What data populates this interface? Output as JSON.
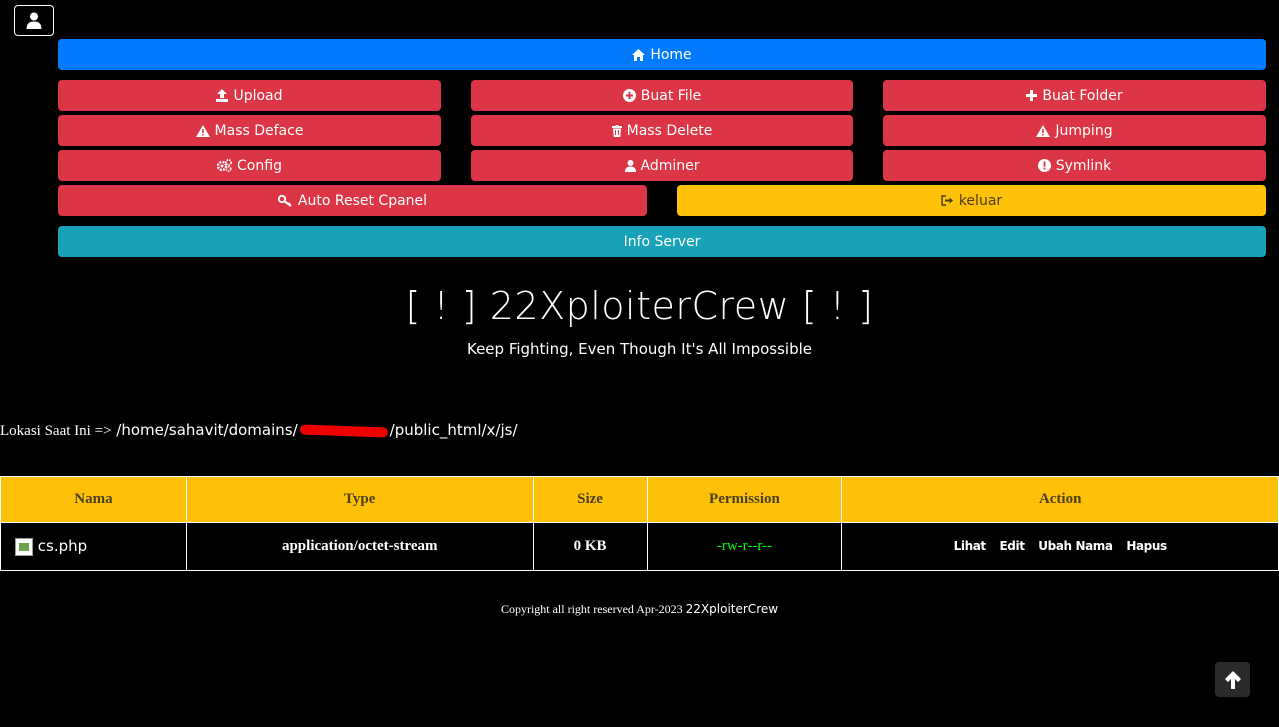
{
  "nav": {
    "home": "Home",
    "upload": "Upload",
    "buat_file": "Buat File",
    "buat_folder": "Buat Folder",
    "mass_deface": "Mass Deface",
    "mass_delete": "Mass Delete",
    "jumping": "Jumping",
    "config": "Config",
    "adminer": "Adminer",
    "symlink": "Symlink",
    "auto_reset_cpanel": "Auto Reset Cpanel",
    "keluar": "keluar",
    "info_server": "Info Server"
  },
  "header": {
    "title": "[ ! ] 22XploiterCrew [ ! ]",
    "subtitle": "Keep Fighting, Even Though It's All Impossible"
  },
  "location": {
    "label": "Lokasi Saat Ini =>",
    "path_start": "/home/sahavit/domains/",
    "path_end": "/public_html/x/js/"
  },
  "table": {
    "headers": [
      "Nama",
      "Type",
      "Size",
      "Permission",
      "Action"
    ],
    "rows": [
      {
        "name": "cs.php",
        "type": "application/octet-stream",
        "size": "0 KB",
        "permission": "-rw-r--r--",
        "actions": [
          "Lihat",
          "Edit",
          "Ubah Nama",
          "Hapus"
        ]
      }
    ]
  },
  "footer": {
    "text": "Copyright all right reserved Apr-2023",
    "brand": "22XploiterCrew"
  },
  "colors": {
    "primary": "#007bff",
    "danger": "#dc3545",
    "warning": "#ffc107",
    "info": "#17a2b8",
    "permission": "#00ff00"
  }
}
